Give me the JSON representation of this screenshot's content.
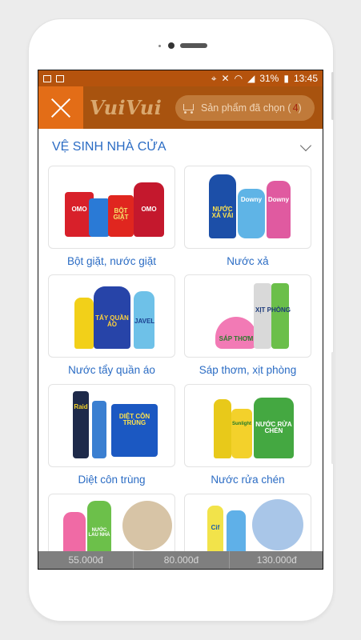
{
  "status": {
    "battery": "31%",
    "time": "13:45"
  },
  "app": {
    "logo": "VuiVui",
    "cart_label": "Sản phẩm đã chọn",
    "cart_count": "4"
  },
  "section": {
    "title": "VỆ SINH NHÀ CỬA"
  },
  "products": [
    {
      "label": "Bột giặt, nước giặt",
      "packs": [
        "OMO",
        "BỘT GIẶT",
        "OMO"
      ]
    },
    {
      "label": "Nước xả",
      "packs": [
        "NƯỚC XẢ VẢI",
        "Downy",
        "Downy"
      ]
    },
    {
      "label": "Nước tẩy quần áo",
      "packs": [
        "TẨY QUẦN ÁO",
        "JAVEL"
      ]
    },
    {
      "label": "Sáp thơm, xịt phòng",
      "packs": [
        "SÁP THƠM",
        "XỊT PHÒNG"
      ]
    },
    {
      "label": "Diệt côn trùng",
      "packs": [
        "Raid",
        "DIỆT CÔN TRÙNG"
      ]
    },
    {
      "label": "Nước rửa chén",
      "packs": [
        "Sunlight",
        "NƯỚC RỬA CHÉN"
      ]
    },
    {
      "label": "",
      "packs": [
        "NƯỚC LAU NHÀ"
      ]
    },
    {
      "label": "",
      "packs": [
        "Cif"
      ]
    }
  ],
  "price_bar": [
    "55.000đ",
    "80.000đ",
    "130.000đ"
  ],
  "colors": {
    "appbar": "#a8530f",
    "close_button": "#e36d17",
    "link_blue": "#2b6cc4"
  }
}
